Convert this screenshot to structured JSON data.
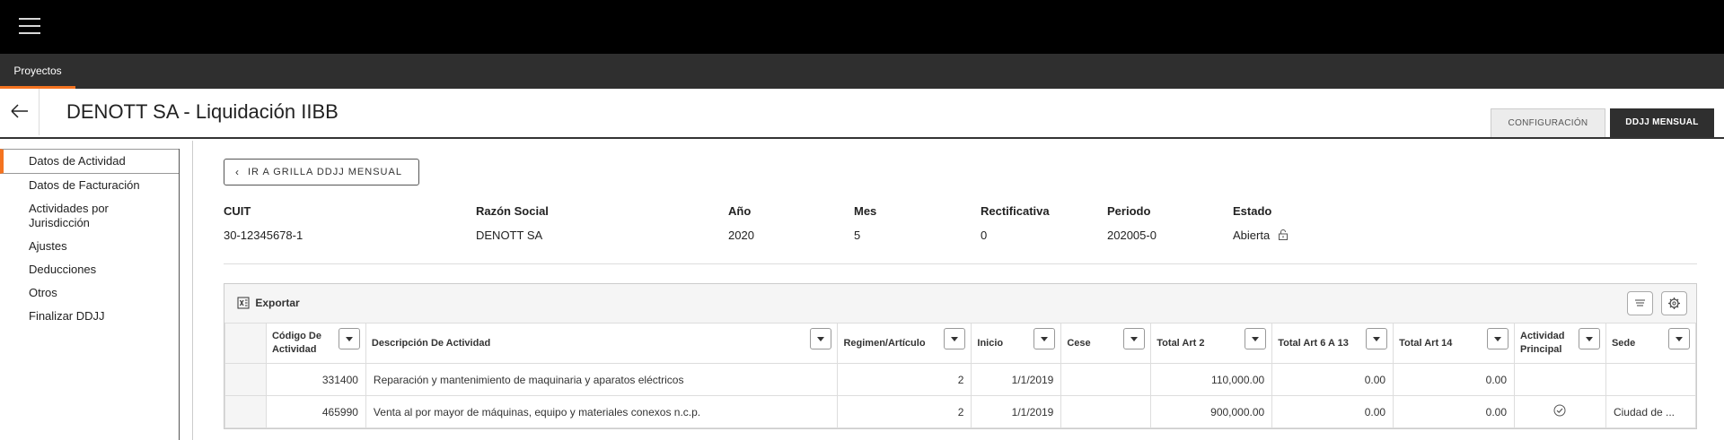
{
  "nav": {
    "tab": "Proyectos"
  },
  "header": {
    "title": "DENOTT SA - Liquidación IIBB",
    "tabs": [
      "CONFIGURACIÓN",
      "DDJJ MENSUAL"
    ]
  },
  "sidebar": {
    "items": [
      {
        "label": "Datos de Actividad"
      },
      {
        "label": "Datos de Facturación"
      },
      {
        "label": "Actividades por Jurisdicción"
      },
      {
        "label": "Ajustes"
      },
      {
        "label": "Deducciones"
      },
      {
        "label": "Otros"
      },
      {
        "label": "Finalizar DDJJ"
      }
    ]
  },
  "main": {
    "back_button": "IR A GRILLA DDJJ MENSUAL",
    "info": [
      {
        "label": "CUIT",
        "value": "30-12345678-1"
      },
      {
        "label": "Razón Social",
        "value": "DENOTT SA"
      },
      {
        "label": "Año",
        "value": "2020"
      },
      {
        "label": "Mes",
        "value": "5"
      },
      {
        "label": "Rectificativa",
        "value": "0"
      },
      {
        "label": "Periodo",
        "value": "202005-0"
      },
      {
        "label": "Estado",
        "value": "Abierta"
      }
    ],
    "export_label": "Exportar",
    "columns": [
      "Código De Actividad",
      "Descripción De Actividad",
      "Regimen/Artículo",
      "Inicio",
      "Cese",
      "Total Art 2",
      "Total Art 6 A 13",
      "Total Art 14",
      "Actividad Principal",
      "Sede"
    ],
    "rows": [
      [
        "331400",
        "Reparación y mantenimiento de maquinaria y aparatos eléctricos",
        "2",
        "1/1/2019",
        "",
        "110,000.00",
        "0.00",
        "0.00",
        "",
        ""
      ],
      [
        "465990",
        "Venta al por mayor de máquinas, equipo y materiales conexos n.c.p.",
        "2",
        "1/1/2019",
        "",
        "900,000.00",
        "0.00",
        "0.00",
        "check",
        "Ciudad de ..."
      ]
    ]
  },
  "colors": {
    "accent": "#f47320",
    "dark": "#2f2f2f"
  }
}
